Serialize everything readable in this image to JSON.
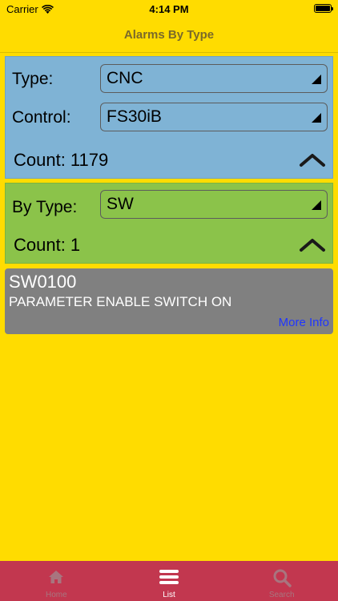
{
  "status_bar": {
    "carrier": "Carrier",
    "time": "4:14 PM"
  },
  "nav": {
    "title": "Alarms By Type"
  },
  "filter_panel": {
    "type_label": "Type:",
    "type_value": "CNC",
    "control_label": "Control:",
    "control_value": "FS30iB",
    "count_label": "Count: 1179",
    "color": "#7FB3D5"
  },
  "by_type_panel": {
    "label": "By Type:",
    "value": "SW",
    "count_label": "Count: 1",
    "color": "#8BC34A"
  },
  "alarm": {
    "code": "SW0100",
    "description": "PARAMETER ENABLE SWITCH ON",
    "more_info": "More Info"
  },
  "tab_bar": {
    "color": "#C2374F",
    "tabs": [
      {
        "label": "Home",
        "icon": "home-icon"
      },
      {
        "label": "List",
        "icon": "list-icon"
      },
      {
        "label": "Search",
        "icon": "search-icon"
      }
    ]
  },
  "background_color": "#FFDC00"
}
